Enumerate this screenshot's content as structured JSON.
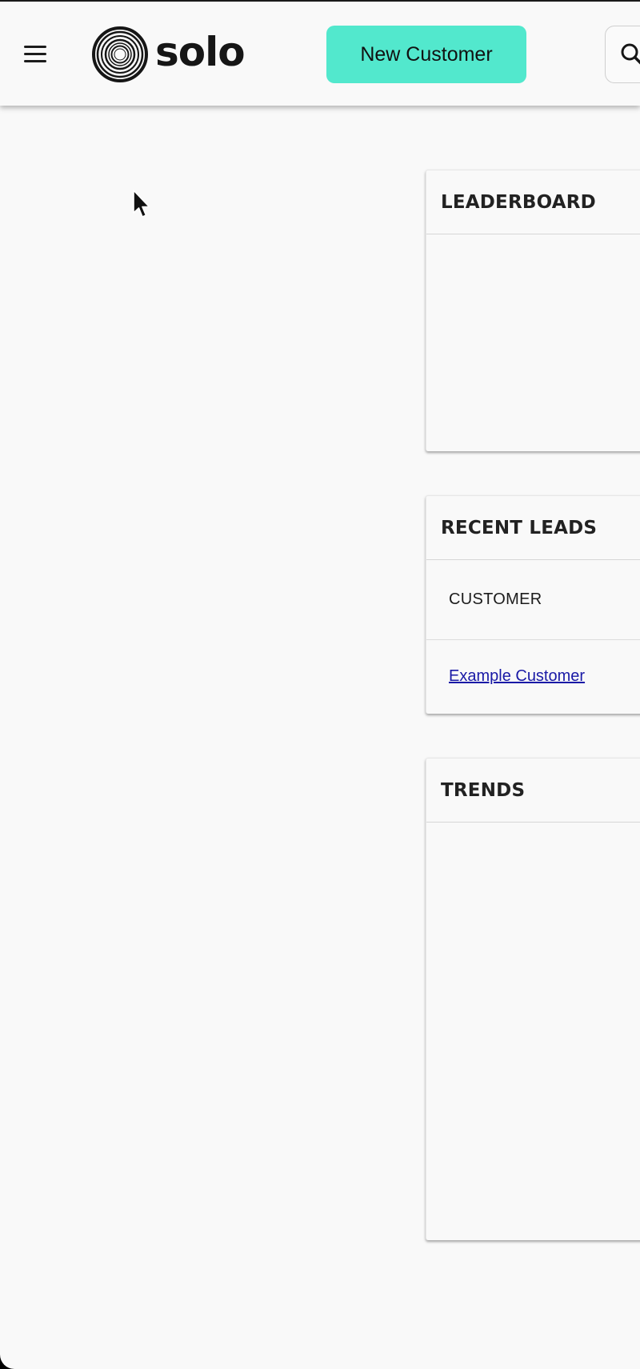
{
  "header": {
    "menu_icon": "hamburger-menu-icon",
    "logo_text": "solo",
    "new_customer_label": "New Customer",
    "search_icon": "search-icon",
    "accent_color": "#52e8cd"
  },
  "cards": {
    "leaderboard": {
      "title": "LEADERBOARD"
    },
    "recent_leads": {
      "title": "RECENT LEADS",
      "columns": [
        "CUSTOMER"
      ],
      "rows": [
        {
          "customer": "Example Customer"
        }
      ]
    },
    "trends": {
      "title": "TRENDS"
    }
  },
  "cursor_icon": "mouse-pointer-icon"
}
